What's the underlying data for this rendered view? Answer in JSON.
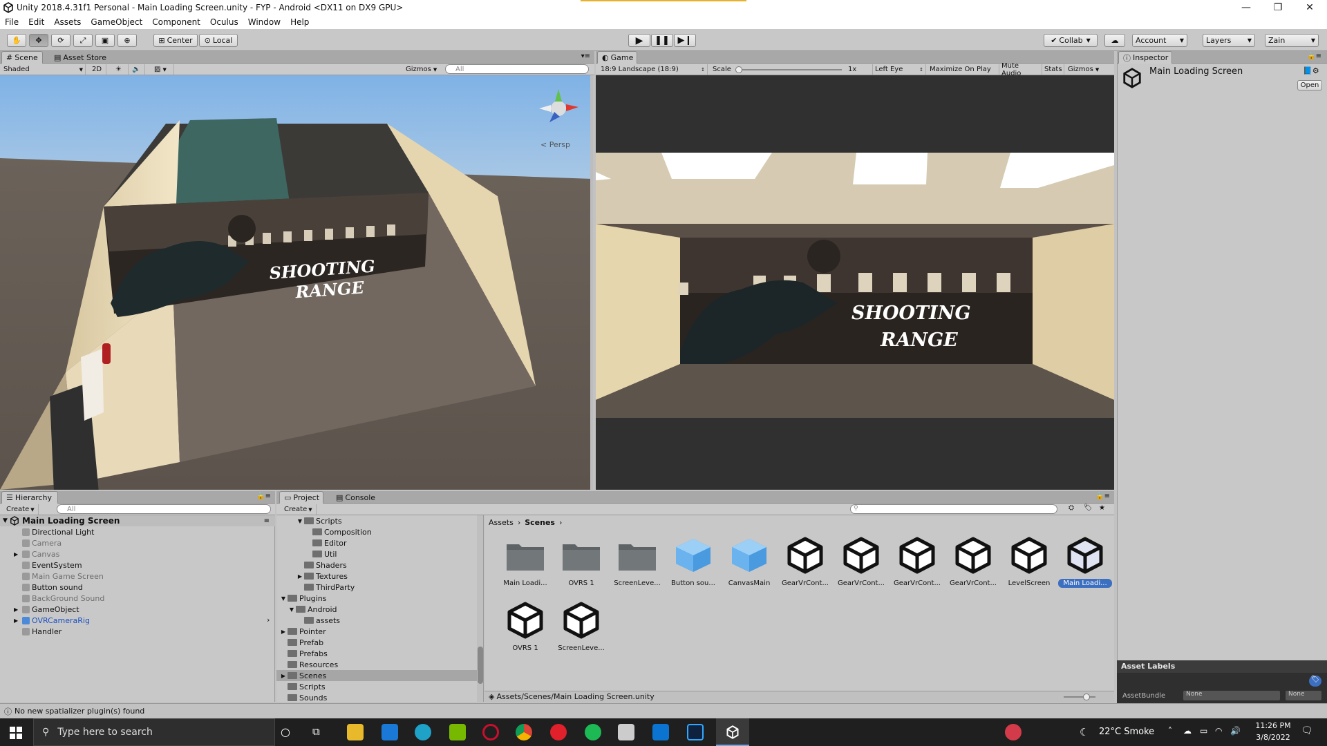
{
  "window": {
    "title": "Unity 2018.4.31f1 Personal - Main Loading Screen.unity - FYP - Android <DX11 on DX9 GPU>",
    "minimize": "—",
    "maximize": "❐",
    "close": "✕"
  },
  "menu": [
    "File",
    "Edit",
    "Assets",
    "GameObject",
    "Component",
    "Oculus",
    "Window",
    "Help"
  ],
  "toolbar": {
    "pivot": "Center",
    "space": "Local",
    "collab": "Collab",
    "account": "Account",
    "layers": "Layers",
    "layout": "Zain"
  },
  "scene": {
    "tabs": [
      "Scene",
      "Asset Store"
    ],
    "shading": "Shaded",
    "mode2d": "2D",
    "gizmos": "Gizmos",
    "search_placeholder": "All",
    "persp": "< Persp",
    "banner_line1": "SHOOTING",
    "banner_line2": "RANGE"
  },
  "game": {
    "tab": "Game",
    "resolution": "18:9 Landscape (18:9)",
    "scale_label": "Scale",
    "scale_value": "1x",
    "eye": "Left Eye",
    "maximize": "Maximize On Play",
    "mute": "Mute Audio",
    "stats": "Stats",
    "gizmos": "Gizmos",
    "banner_line1": "SHOOTING",
    "banner_line2": "RANGE"
  },
  "inspector": {
    "tab": "Inspector",
    "object_name": "Main Loading Screen",
    "open_button": "Open",
    "asset_labels": "Asset Labels",
    "assetbundle_label": "AssetBundle",
    "assetbundle_value": "None",
    "variant_value": "None"
  },
  "hierarchy": {
    "tab": "Hierarchy",
    "create": "Create",
    "search_placeholder": "All",
    "scene_name": "Main Loading Screen",
    "items": [
      {
        "label": "Directional Light",
        "style": "normal",
        "arrow": ""
      },
      {
        "label": "Camera",
        "style": "grey",
        "arrow": ""
      },
      {
        "label": "Canvas",
        "style": "grey",
        "arrow": "▶"
      },
      {
        "label": "EventSystem",
        "style": "normal",
        "arrow": ""
      },
      {
        "label": "Main Game Screen",
        "style": "grey",
        "arrow": ""
      },
      {
        "label": "Button sound",
        "style": "normal",
        "arrow": ""
      },
      {
        "label": "BackGround Sound",
        "style": "grey",
        "arrow": ""
      },
      {
        "label": "GameObject",
        "style": "normal",
        "arrow": "▶"
      },
      {
        "label": "OVRCameraRig",
        "style": "blue",
        "arrow": "▶"
      },
      {
        "label": "Handler",
        "style": "normal",
        "arrow": ""
      }
    ]
  },
  "project": {
    "tabs": [
      "Project",
      "Console"
    ],
    "create": "Create",
    "tree": [
      {
        "label": "Scripts",
        "indent": 3,
        "arrow": "▼"
      },
      {
        "label": "Composition",
        "indent": 4,
        "arrow": ""
      },
      {
        "label": "Editor",
        "indent": 4,
        "arrow": ""
      },
      {
        "label": "Util",
        "indent": 4,
        "arrow": ""
      },
      {
        "label": "Shaders",
        "indent": 3,
        "arrow": ""
      },
      {
        "label": "Textures",
        "indent": 3,
        "arrow": "▶"
      },
      {
        "label": "ThirdParty",
        "indent": 3,
        "arrow": ""
      },
      {
        "label": "Plugins",
        "indent": 1,
        "arrow": "▼"
      },
      {
        "label": "Android",
        "indent": 2,
        "arrow": "▼"
      },
      {
        "label": "assets",
        "indent": 3,
        "arrow": ""
      },
      {
        "label": "Pointer",
        "indent": 1,
        "arrow": "▶"
      },
      {
        "label": "Prefab",
        "indent": 1,
        "arrow": ""
      },
      {
        "label": "Prefabs",
        "indent": 1,
        "arrow": ""
      },
      {
        "label": "Resources",
        "indent": 1,
        "arrow": ""
      },
      {
        "label": "Scenes",
        "indent": 1,
        "arrow": "▶"
      },
      {
        "label": "Scripts",
        "indent": 1,
        "arrow": ""
      },
      {
        "label": "Sounds",
        "indent": 1,
        "arrow": ""
      }
    ],
    "breadcrumb": [
      "Assets",
      "Scenes"
    ],
    "assets": [
      {
        "label": "Main Loadi...",
        "kind": "folder"
      },
      {
        "label": "OVRS 1",
        "kind": "folder"
      },
      {
        "label": "ScreenLeve...",
        "kind": "folder"
      },
      {
        "label": "Button sou...",
        "kind": "cube"
      },
      {
        "label": "CanvasMain",
        "kind": "cube"
      },
      {
        "label": "GearVrCont...",
        "kind": "unity"
      },
      {
        "label": "GearVrCont...",
        "kind": "unity"
      },
      {
        "label": "GearVrCont...",
        "kind": "unity"
      },
      {
        "label": "GearVrCont...",
        "kind": "unity"
      },
      {
        "label": "LevelScreen",
        "kind": "unity"
      },
      {
        "label": "Main Loadi...",
        "kind": "unity-selected"
      },
      {
        "label": "OVRS 1",
        "kind": "unity"
      },
      {
        "label": "ScreenLeve...",
        "kind": "unity"
      }
    ],
    "path": "Assets/Scenes/Main Loading Screen.unity"
  },
  "status": "No new spatializer plugin(s) found",
  "taskbar": {
    "search_placeholder": "Type here to search",
    "weather": "22°C  Smoke",
    "time": "11:26 PM",
    "date": "3/8/2022"
  },
  "colors": {
    "chrome": "#c2c2c2",
    "selection": "#3d6fc0",
    "taskbar": "#1f1f1f"
  }
}
